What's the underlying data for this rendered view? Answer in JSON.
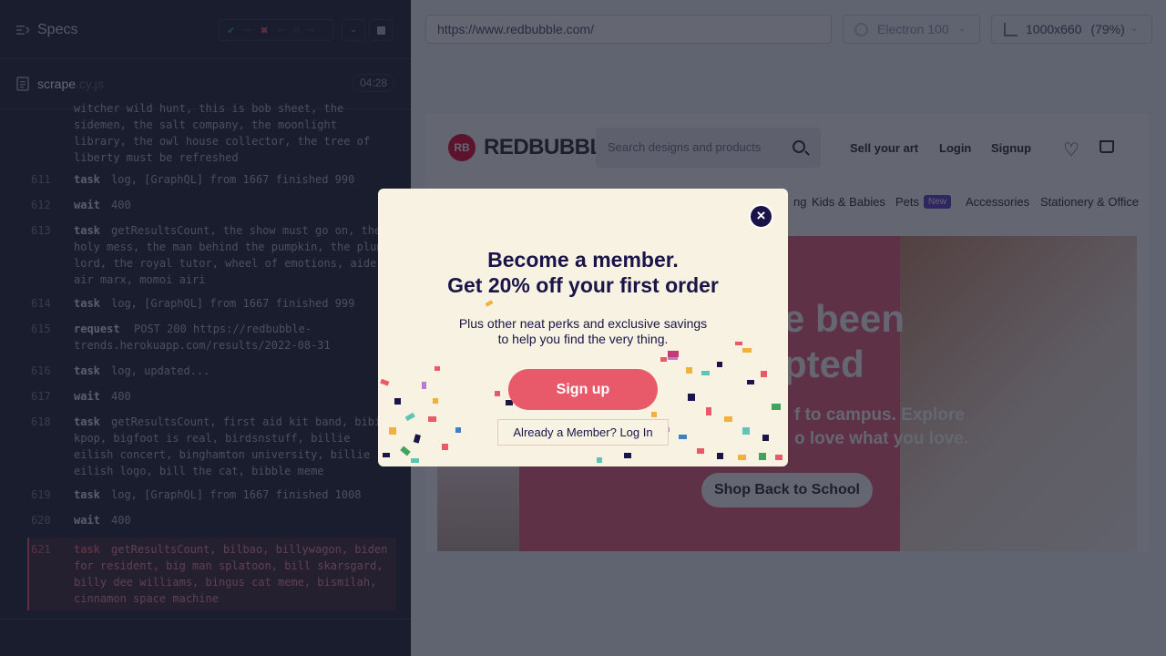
{
  "left": {
    "specs_title": "Specs",
    "stats": {
      "passed": "--",
      "failed": "--",
      "pending": "--"
    },
    "file": {
      "name": "scrape",
      "ext": ".cy.js",
      "time": "04:28"
    },
    "log": [
      {
        "num": "",
        "cmd": "",
        "msg": "witcher wild hunt, this is bob sheet, the\nsidemen, the salt company, the moonlight\nlibrary, the owl house collector, the tree of\nliberty must be refreshed"
      },
      {
        "num": "611",
        "cmd": "task",
        "msg": "log, [GraphQL] from 1667 finished 990"
      },
      {
        "num": "612",
        "cmd": "wait",
        "msg": "400"
      },
      {
        "num": "613",
        "cmd": "task",
        "msg": "getResultsCount, the show must go on, the\nholy mess, the man behind the pumpkin, the plum\nlord, the royal tutor, wheel of emotions, aide\nair marx, momoi airi"
      },
      {
        "num": "614",
        "cmd": "task",
        "msg": "log, [GraphQL] from 1667 finished 999"
      },
      {
        "num": "615",
        "cmd": "request",
        "msg": "POST 200 https://redbubble-\ntrends.herokuapp.com/results/2022-08-31"
      },
      {
        "num": "616",
        "cmd": "task",
        "msg": "log, updated..."
      },
      {
        "num": "617",
        "cmd": "wait",
        "msg": "400"
      },
      {
        "num": "618",
        "cmd": "task",
        "msg": "getResultsCount, first aid kit band, bibi\nkpop, bigfoot is real, birdsnstuff, billie\neilish concert, binghamton university, billie\neilish logo, bill the cat, bibble meme"
      },
      {
        "num": "619",
        "cmd": "task",
        "msg": "log, [GraphQL] from 1667 finished 1008"
      },
      {
        "num": "620",
        "cmd": "wait",
        "msg": "400"
      },
      {
        "num": "621",
        "cmd": "task",
        "msg": "getResultsCount, bilbao, billywagon, biden\nfor resident, big man splatoon, bill skarsgard,\nbilly dee williams, bingus cat meme, bismilah,\ncinnamon space machine"
      }
    ]
  },
  "toolbar": {
    "url": "https://www.redbubble.com/",
    "browser": "Electron 100",
    "viewport": "1000x660",
    "scale": "(79%)"
  },
  "site": {
    "logo_mark": "RB",
    "logo_word": "REDBUBBLE",
    "search_placeholder": "Search designs and products",
    "sell": "Sell your art",
    "login": "Login",
    "signup": "Signup",
    "nav": [
      "ng",
      "Kids & Babies",
      "Pets",
      "Accessories",
      "Stationery & Office"
    ],
    "new_badge": "New",
    "hero_heading": "e been\npted",
    "hero_text": "f to campus. Explore\no love what you love.",
    "hero_button": "Shop Back to School"
  },
  "modal": {
    "title": "Become a member.\nGet 20% off your first order",
    "subtitle": "Plus other neat perks and exclusive savings\nto help you find the very thing.",
    "signup": "Sign up",
    "login": "Already a Member? Log In",
    "close": "×"
  }
}
